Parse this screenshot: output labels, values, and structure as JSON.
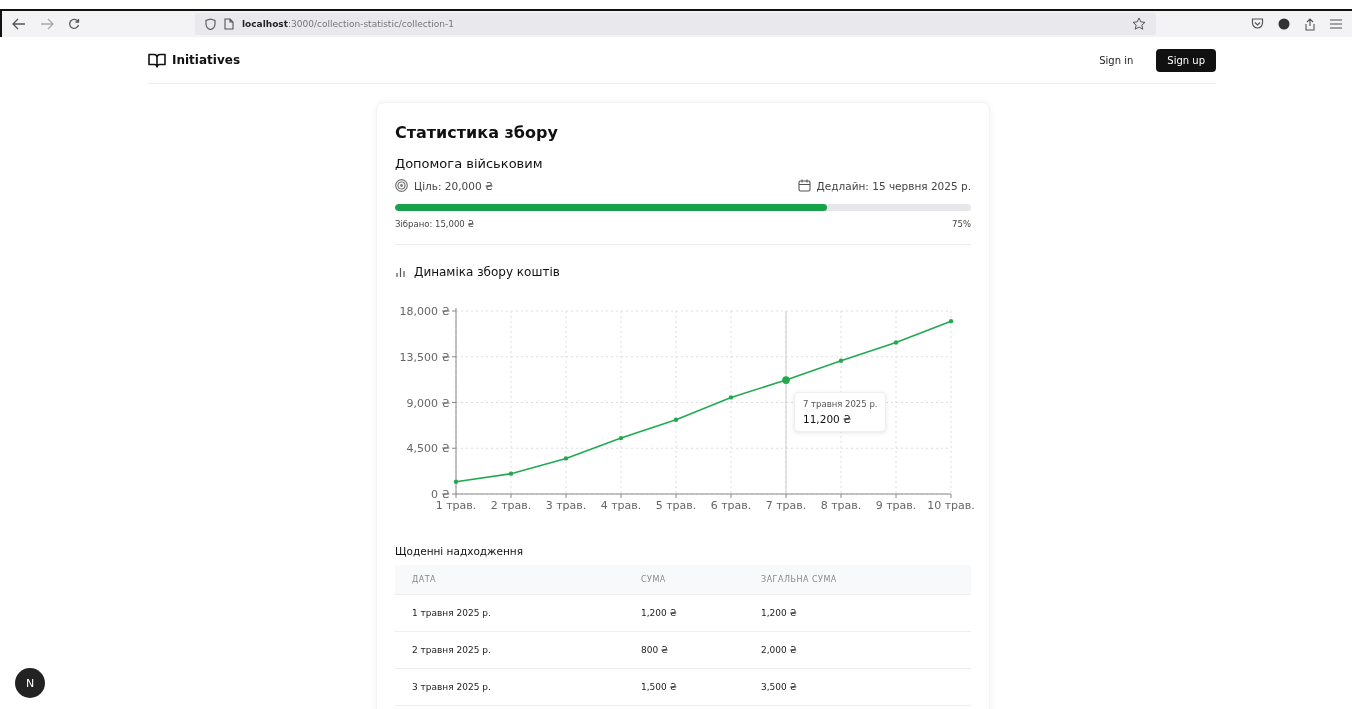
{
  "browser": {
    "url": "**localhost**:3000/collection-statistic/collection-1"
  },
  "nav": {
    "brand": "Initiatives",
    "sign_in": "Sign in",
    "sign_up": "Sign up"
  },
  "card": {
    "title": "Статистика збору",
    "collection_name": "Допомога військовим",
    "goal": "Ціль: 20,000 ₴",
    "deadline": "Дедлайн: 15 червня 2025 р.",
    "progress": {
      "level": 0.75,
      "collected": "Зібрано: 15,000 ₴",
      "percent": "75%"
    }
  },
  "chart_section": {
    "heading": "Динаміка збору коштів",
    "chart_data": {
      "type": "line",
      "categories": [
        "1 трав.",
        "2 трав.",
        "3 трав.",
        "4 трав.",
        "5 трав.",
        "6 трав.",
        "7 трав.",
        "8 трав.",
        "9 трав.",
        "10 трав."
      ],
      "grid": true,
      "ref_lines": [
        {
          "axis": "x",
          "value": "7 трав.",
          "color": "#cccccc"
        }
      ],
      "series": [
        {
          "color": "#22a94f",
          "values": [
            1200,
            2000,
            3500,
            5500,
            7300,
            9500,
            11200,
            13100,
            14900,
            17000
          ]
        }
      ],
      "ylim": [
        0,
        18000
      ],
      "yticks": [
        {
          "value": 0,
          "label": "0 ₴"
        },
        {
          "value": 4500,
          "label": "4,500 ₴"
        },
        {
          "value": 9000,
          "label": "9,000 ₴"
        },
        {
          "value": 13500,
          "label": "13,500 ₴"
        },
        {
          "value": 18000,
          "label": "18,000 ₴"
        }
      ]
    },
    "points": [
      {
        "selected": false
      },
      {
        "selected": false
      },
      {
        "selected": false
      },
      {
        "selected": false
      },
      {
        "selected": false
      },
      {
        "selected": false
      },
      {
        "selected": true
      },
      {
        "selected": false
      },
      {
        "selected": false
      },
      {
        "selected": false
      }
    ],
    "tooltip": {
      "date": "7 травня 2025 р.",
      "value": "11,200 ₴"
    }
  },
  "table": {
    "title": "Щоденні надходження",
    "columns": [
      "ДАТА",
      "СУМА",
      "ЗАГАЛЬНА СУМА"
    ],
    "rows": [
      [
        "1 травня 2025 р.",
        "1,200 ₴",
        "1,200 ₴"
      ],
      [
        "2 травня 2025 р.",
        "800 ₴",
        "2,000 ₴"
      ],
      [
        "3 травня 2025 р.",
        "1,500 ₴",
        "3,500 ₴"
      ]
    ]
  },
  "dev_badge": "N"
}
